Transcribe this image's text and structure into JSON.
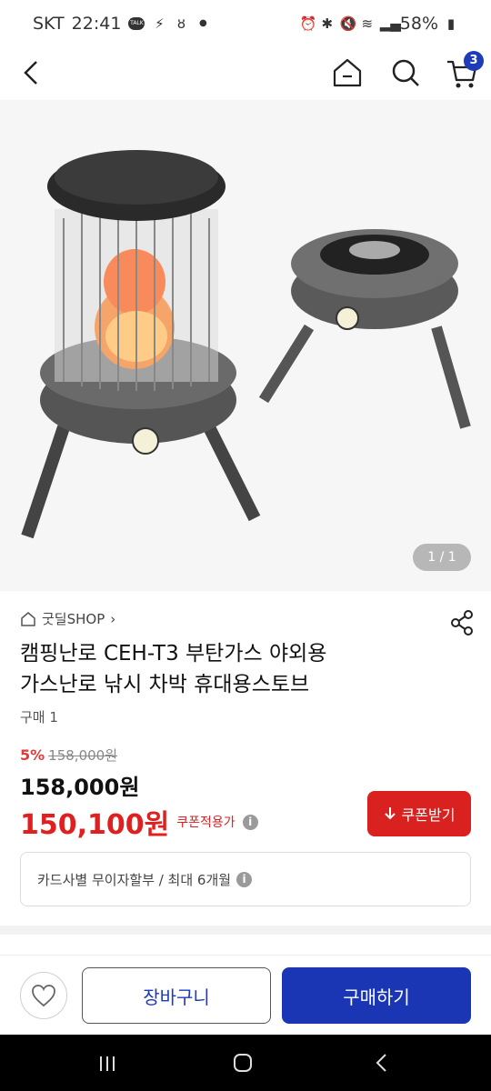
{
  "status_bar": {
    "carrier": "SKT",
    "time": "22:41",
    "battery": "58%",
    "icons": [
      "talk-icon",
      "bolt-icon",
      "nav-icon",
      "dot-icon",
      "alarm-icon",
      "bluetooth-icon",
      "mute-icon",
      "wifi-icon",
      "signal-icon",
      "battery-icon"
    ]
  },
  "app_bar": {
    "cart_count": "3"
  },
  "hero": {
    "page_indicator": "1 / 1"
  },
  "product": {
    "store_name": "굿딜SHOP",
    "store_chevron": "›",
    "title_line1": "캠핑난로 CEH-T3 부탄가스 야외용",
    "title_line2": "가스난로 낚시 차박 휴대용스토브",
    "sold": "구매 1",
    "discount_rate": "5%",
    "original_price": "158,000원",
    "price": "158,000원",
    "coupon_price": "150,100원",
    "coupon_label": "쿠폰적용가",
    "coupon_button": "쿠폰받기",
    "card_info": "카드사별 무이자할부 / 최대 6개월"
  },
  "bottom_bar": {
    "add_to_cart": "장바구니",
    "buy_now": "구매하기"
  },
  "colors": {
    "accent_blue": "#1a36b5",
    "sale_red": "#e02020",
    "coupon_red": "#d9211f"
  }
}
